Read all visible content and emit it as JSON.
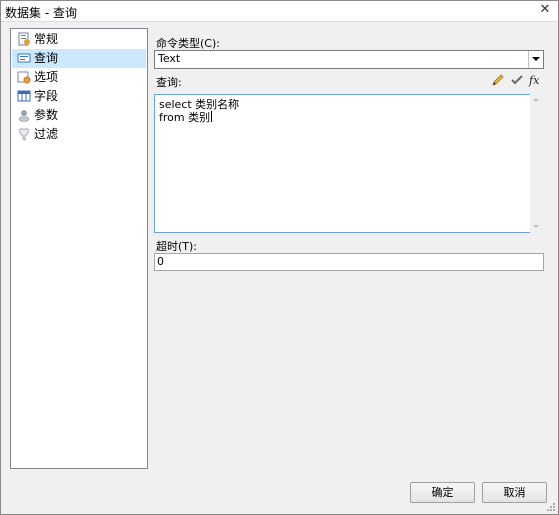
{
  "window": {
    "title": "数据集 - 查询",
    "close_glyph": "✕"
  },
  "sidebar": {
    "items": [
      {
        "label": "常规",
        "icon": "general-icon"
      },
      {
        "label": "查询",
        "icon": "query-icon",
        "selected": true
      },
      {
        "label": "选项",
        "icon": "options-icon"
      },
      {
        "label": "字段",
        "icon": "fields-icon"
      },
      {
        "label": "参数",
        "icon": "parameters-icon"
      },
      {
        "label": "过滤",
        "icon": "filter-icon"
      }
    ]
  },
  "form": {
    "command_type_label": "命令类型(C):",
    "command_type_value": "Text",
    "query_label": "查询:",
    "query_lines": [
      "select 类别名称",
      "from 类别"
    ],
    "timeout_label": "超时(T):",
    "timeout_value": "0"
  },
  "buttons": {
    "ok": "确定",
    "cancel": "取消"
  },
  "colors": {
    "selection": "#cce8ff",
    "focus_border": "#6aa0dc"
  }
}
